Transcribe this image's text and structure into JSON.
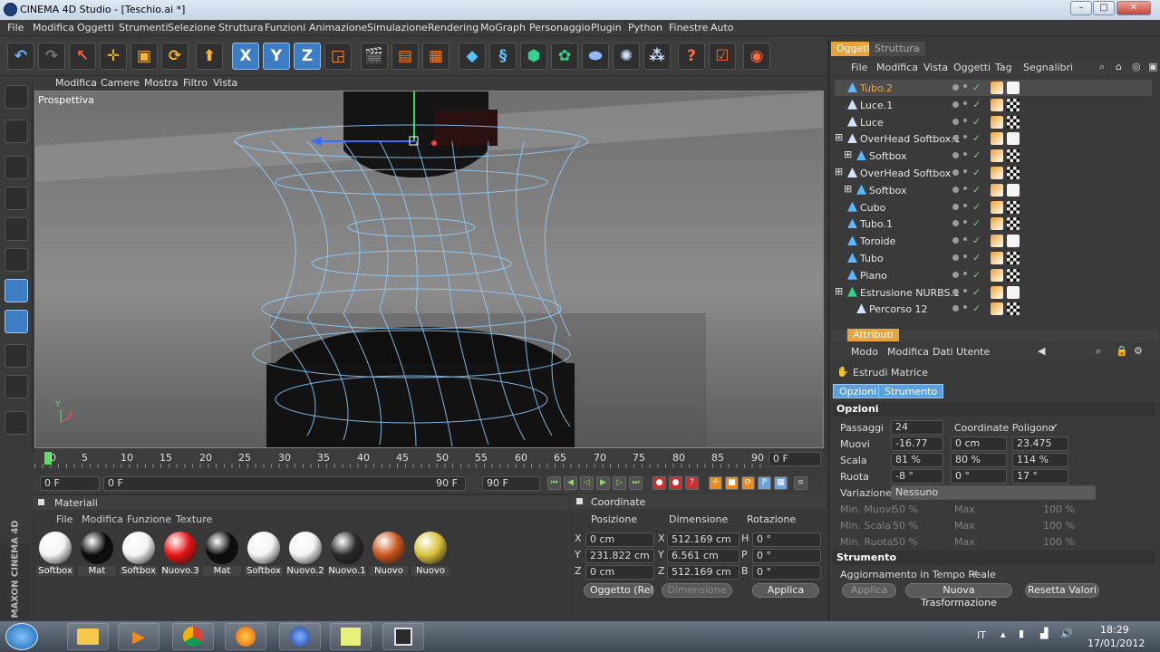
{
  "window": {
    "title": "CINEMA 4D Studio - [Teschio.ai *]"
  },
  "menu": [
    "File",
    "Modifica",
    "Oggetti",
    "Strumenti",
    "Selezione",
    "Struttura",
    "Funzioni",
    "Animazione",
    "Simulazione",
    "Rendering",
    "MoGraph",
    "Personaggio",
    "Plugin",
    "Python",
    "Finestre",
    "Auto"
  ],
  "viewport": {
    "menu": [
      "Modifica",
      "Camere",
      "Mostra",
      "Filtro",
      "Vista"
    ],
    "label": "Prospettiva"
  },
  "timeline": {
    "ticks": [
      "0",
      "5",
      "10",
      "15",
      "20",
      "25",
      "30",
      "35",
      "40",
      "45",
      "50",
      "55",
      "60",
      "65",
      "70",
      "75",
      "80",
      "85",
      "90"
    ],
    "current_frame": "0 F",
    "start": "0 F",
    "slider_start": "0 F",
    "slider_end": "90 F",
    "end": "90 F"
  },
  "materials": {
    "title": "Materiali",
    "menu": [
      "File",
      "Modifica",
      "Funzione",
      "Texture"
    ],
    "items": [
      {
        "name": "Softbox",
        "color": "#f4f4f4"
      },
      {
        "name": "Mat",
        "color": "#0c0c0c"
      },
      {
        "name": "Softbox",
        "color": "#f4f4f4"
      },
      {
        "name": "Nuovo.3",
        "color": "#e61414"
      },
      {
        "name": "Mat",
        "color": "#0c0c0c"
      },
      {
        "name": "Softbox",
        "color": "#f4f4f4"
      },
      {
        "name": "Nuovo.2",
        "color": "#f4f4f4"
      },
      {
        "name": "Nuovo.1",
        "color": "#2a2a2a"
      },
      {
        "name": "Nuovo",
        "color": "#c9551e"
      },
      {
        "name": "Nuovo",
        "color": "#d8c23a"
      }
    ]
  },
  "coordinates": {
    "title": "Coordinate",
    "headers": [
      "Posizione",
      "Dimensione",
      "Rotazione"
    ],
    "rows": [
      {
        "axis": "X",
        "pos": "0 cm",
        "dim_axis": "X",
        "dim": "512.169 cm",
        "rot_axis": "H",
        "rot": "0 °"
      },
      {
        "axis": "Y",
        "pos": "231.822 cm",
        "dim_axis": "Y",
        "dim": "6.561 cm",
        "rot_axis": "P",
        "rot": "0 °"
      },
      {
        "axis": "Z",
        "pos": "0 cm",
        "dim_axis": "Z",
        "dim": "512.169 cm",
        "rot_axis": "B",
        "rot": "0 °"
      }
    ],
    "mode": "Oggetto (Rel",
    "dimension_btn": "Dimensione",
    "apply_btn": "Applica"
  },
  "objects": {
    "tabs": [
      "Oggetti",
      "Struttura"
    ],
    "menu": [
      "File",
      "Modifica",
      "Vista",
      "Oggetti",
      "Tag",
      "Segnalibri"
    ],
    "rows": [
      {
        "name": "Tubo.2",
        "selected": true,
        "indent": 0
      },
      {
        "name": "Luce.1",
        "indent": 0
      },
      {
        "name": "Luce",
        "indent": 0
      },
      {
        "name": "OverHead Softbox.1",
        "indent": 0,
        "expand": true
      },
      {
        "name": "Softbox",
        "indent": 1,
        "expand": true
      },
      {
        "name": "OverHead Softbox",
        "indent": 0,
        "expand": true
      },
      {
        "name": "Softbox",
        "indent": 1,
        "expand": true
      },
      {
        "name": "Cubo",
        "indent": 0
      },
      {
        "name": "Tubo.1",
        "indent": 0
      },
      {
        "name": "Toroide",
        "indent": 0
      },
      {
        "name": "Tubo",
        "indent": 0
      },
      {
        "name": "Piano",
        "indent": 0
      },
      {
        "name": "Estrusione NURBS.1",
        "indent": 0,
        "expand": true
      },
      {
        "name": "Percorso 12",
        "indent": 1
      }
    ]
  },
  "attributes": {
    "title": "Attributi",
    "menu": [
      "Modo",
      "Modifica",
      "Dati Utente"
    ],
    "tool": "Estrudi Matrice",
    "tabs": [
      "Opzioni",
      "Strumento"
    ],
    "section_options": "Opzioni",
    "passaggi_label": "Passaggi",
    "passaggi": "24",
    "coord_poly_label": "Coordinate Poligono",
    "coord_poly_check": "✓",
    "muovi_label": "Muovi",
    "muovi": [
      "-16.77 cm",
      "0 cm",
      "23.475 cm"
    ],
    "scala_label": "Scala",
    "scala": [
      "81 %",
      "80 %",
      "114 %"
    ],
    "ruota_label": "Ruota",
    "ruota": [
      "-8 °",
      "0 °",
      "17 °"
    ],
    "variazione_label": "Variazione",
    "variazione": "Nessuno",
    "min_muovi_label": "Min. Muovi",
    "min_muovi": "50 %",
    "max_label": "Max",
    "max_muovi": "100 %",
    "min_scala_label": "Min. Scala",
    "min_scala": "50 %",
    "max_scala": "100 %",
    "min_ruota_label": "Min. Ruota",
    "min_ruota": "50 %",
    "max_ruota": "100 %",
    "section_tool": "Strumento",
    "realtime_label": "Aggiornamento in Tempo Reale",
    "realtime_check": "✓",
    "buttons": [
      "Applica",
      "Nuova Trasformazione",
      "Resetta Valori"
    ]
  },
  "brand": "MAXON CINEMA 4D",
  "taskbar": {
    "lang": "IT",
    "time": "18:29",
    "date": "17/01/2012"
  }
}
